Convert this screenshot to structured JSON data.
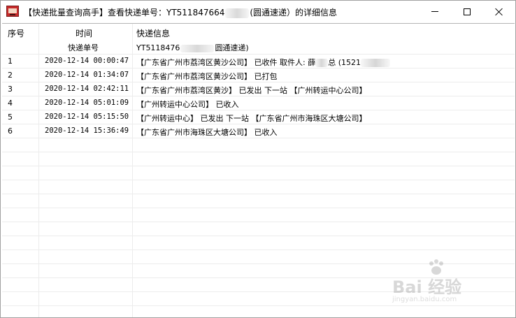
{
  "window": {
    "title": "【快递批量查询高手】查看快递单号：YT5118476641... (圆通速递）的详细信息",
    "title_left": "【快递批量查询高手】查看快递单号：YT511847664",
    "title_right": "(圆通速递）的详细信息"
  },
  "table": {
    "headers": {
      "no": "序号",
      "time": "时间",
      "info": "快递信息"
    },
    "tracking_label": "快递单号",
    "tracking_number_left": "YT5118476",
    "tracking_number_right": "圆通速递)",
    "rows": [
      {
        "no": "1",
        "time": "2020-12-14 00:00:47",
        "info": "【广东省广州市荔湾区黄沙公司】 已收件 取件人: 薛",
        "info_tail": "总 (1521"
      },
      {
        "no": "2",
        "time": "2020-12-14 01:34:07",
        "info": "【广东省广州市荔湾区黄沙公司】 已打包",
        "info_tail": ""
      },
      {
        "no": "3",
        "time": "2020-12-14 02:42:11",
        "info": "【广东省广州市荔湾区黄沙】 已发出 下一站 【广州转运中心公司】",
        "info_tail": ""
      },
      {
        "no": "4",
        "time": "2020-12-14 05:01:09",
        "info": "【广州转运中心公司】 已收入",
        "info_tail": ""
      },
      {
        "no": "5",
        "time": "2020-12-14 05:15:50",
        "info": "【广州转运中心】 已发出 下一站 【广东省广州市海珠区大塘公司】",
        "info_tail": ""
      },
      {
        "no": "6",
        "time": "2020-12-14 15:36:49",
        "info": "【广东省广州市海珠区大塘公司】 已收入",
        "info_tail": ""
      }
    ]
  },
  "watermark": {
    "brand": "Bai 经验",
    "sub": "jingyan.baidu.com"
  },
  "colors": {
    "grid_line": "#ececec",
    "border": "#a0a0a0",
    "app_icon": "#c62a2a"
  }
}
